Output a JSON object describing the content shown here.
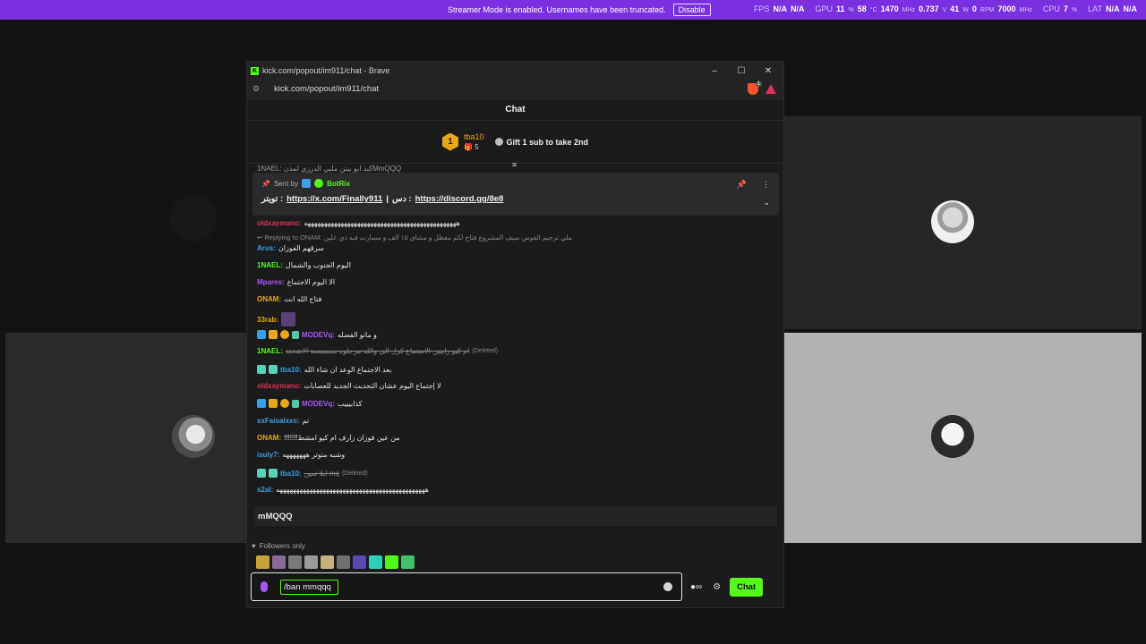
{
  "banner": {
    "text": "Streamer Mode is enabled. Usernames have been truncated.",
    "button": "Disable"
  },
  "metrics": [
    {
      "label": "FPS",
      "parts": [
        {
          "v": "N/A"
        },
        {
          "v": "N/A"
        }
      ]
    },
    {
      "label": "GPU",
      "parts": [
        {
          "v": "11",
          "u": "%"
        },
        {
          "v": "58",
          "u": "°C"
        },
        {
          "v": "1470",
          "u": "MHz"
        },
        {
          "v": "0.737",
          "u": "V"
        },
        {
          "v": "41",
          "u": "W"
        },
        {
          "v": "0",
          "u": "RPM"
        },
        {
          "v": "7000",
          "u": "MHz"
        }
      ]
    },
    {
      "label": "CPU",
      "parts": [
        {
          "v": "7",
          "u": "%"
        }
      ]
    },
    {
      "label": "LAT",
      "parts": [
        {
          "v": "N/A"
        },
        {
          "v": "N/A"
        }
      ]
    }
  ],
  "window": {
    "title": "kick.com/popout/im911/chat - Brave",
    "url": "kick.com/popout/im911/chat",
    "brave_badge": "1"
  },
  "chat": {
    "header": "Chat",
    "leader": {
      "rank": "1",
      "name": "tba10",
      "count": "5",
      "cta": "Gift 1 sub to take 2nd"
    },
    "top_cut_text": "1NAEL: كبد ابو بيتن ملبي الدرزي لمذنMmQQQ",
    "pinned": {
      "sent_by": "Sent by",
      "bot": "BotRix",
      "label_x": "تويتر :",
      "link_x": "https://x.com/Finally911",
      "sep": "|",
      "label_dc": "دس :",
      "link_dc": "https://discord.gg/8e8"
    },
    "messages": [
      {
        "user": "oldxaymano",
        "color": "#e0325a",
        "text": "ههههههههههههههههههههههههههههههههههههههههههههههه"
      },
      {
        "reply": "Replying to ONAM: ملي ترجيم القوس سيف المشروع فتاح لكم معطل و مشاي ١٥ الف و مسارت فيه ذي علين"
      },
      {
        "user": "Arus",
        "color": "#3aa0e6",
        "text": "سرقهم الفوزان"
      },
      {
        "user": "1NAEL",
        "color": "#53fc18",
        "text": "اليوم الجنوب والشمال"
      },
      {
        "user": "Mpares",
        "color": "#a855f7",
        "text": "الا اليوم الاجتماع"
      },
      {
        "user": "ONAM",
        "color": "#e7a81c",
        "text": "فتاح الله انت"
      },
      {
        "user": "33rab",
        "color": "#e7a81c",
        "text": ""
      },
      {
        "user": "MODEVq",
        "color": "#a855f7",
        "text": "و ماتو الفضله"
      },
      {
        "user": "1NAEL",
        "color": "#53fc18",
        "text": "ام كيو رايبين الاستماع كرل الي والله مرجلوه سيسيسة الاشحته",
        "deleted": "(Deleted)"
      },
      {
        "user": "tba10",
        "color": "#3aa0e6",
        "text": "بعد الاجتماع الوعد ان شاء الله"
      },
      {
        "user": "oldxaymano",
        "color": "#e0325a",
        "text": "لا إجتماع اليوم عشان التحديث الجديد للعصابات"
      },
      {
        "user": "MODEVq",
        "color": "#a855f7",
        "text": "كذابيييب"
      },
      {
        "user": "xxFaisalxxs",
        "color": "#3aa0e6",
        "text": "تم"
      },
      {
        "user": "ONAM",
        "color": "#e7a81c",
        "text": "!!!!!!!من عين فوزان زارف ام كيو امشط"
      },
      {
        "user": "isuly7",
        "color": "#3aa0e6",
        "text": "وشبه متوتر هههههههه"
      },
      {
        "user": "tba10",
        "color": "#3aa0e6",
        "text": "ابلا تعين mq",
        "deleted": "(Deleted)"
      },
      {
        "user": "s2al",
        "color": "#3aa0e6",
        "text": "هههههههههههههههههههههههههههههههههههههههههههههه"
      }
    ],
    "draft_preview": "mMQQQ",
    "followers_only": "Followers only",
    "input_value": "/ban mmqqq",
    "send": "Chat"
  }
}
